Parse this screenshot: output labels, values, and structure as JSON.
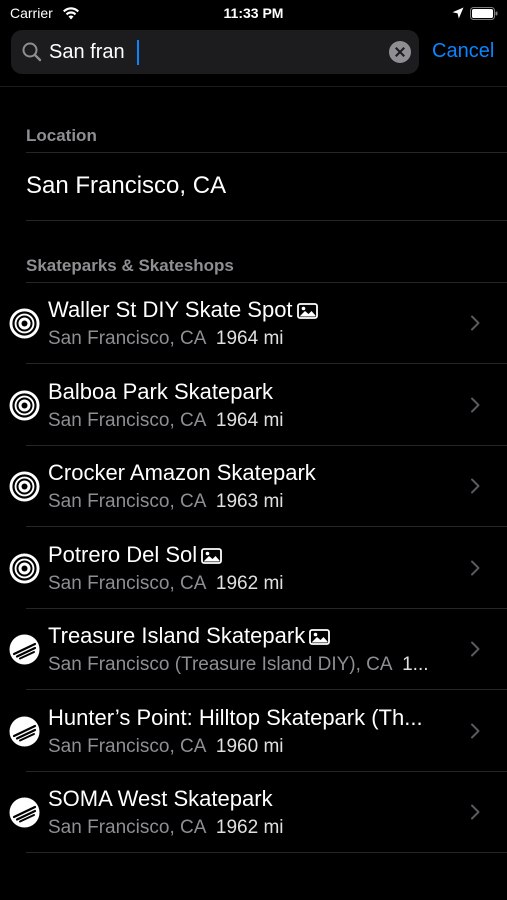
{
  "status_bar": {
    "carrier": "Carrier",
    "time": "11:33 PM"
  },
  "search": {
    "value": "San fran",
    "cancel_label": "Cancel"
  },
  "location_section": {
    "header": "Location",
    "item": "San Francisco, CA"
  },
  "parks_section": {
    "header": "Skateparks & Skateshops",
    "items": [
      {
        "title": "Waller St DIY Skate Spot",
        "subtitle": "San Francisco, CA",
        "distance": "1964 mi",
        "icon": "skatepark-bowl-icon",
        "has_photo": true
      },
      {
        "title": "Balboa Park Skatepark",
        "subtitle": "San Francisco, CA",
        "distance": "1964 mi",
        "icon": "skatepark-bowl-icon",
        "has_photo": false
      },
      {
        "title": "Crocker Amazon Skatepark",
        "subtitle": "San Francisco, CA",
        "distance": "1963 mi",
        "icon": "skatepark-bowl-icon",
        "has_photo": false
      },
      {
        "title": "Potrero Del Sol",
        "subtitle": "San Francisco, CA",
        "distance": "1962 mi",
        "icon": "skatepark-bowl-icon",
        "has_photo": true
      },
      {
        "title": "Treasure Island Skatepark",
        "subtitle": "San Francisco (Treasure Island DIY), CA",
        "distance": "1...",
        "icon": "skatepark-ramp-icon",
        "has_photo": true
      },
      {
        "title": "Hunter’s Point: Hilltop Skatepark (Th...",
        "subtitle": "San Francisco, CA",
        "distance": "1960 mi",
        "icon": "skatepark-ramp-icon",
        "has_photo": false
      },
      {
        "title": "SOMA West Skatepark",
        "subtitle": "San Francisco, CA",
        "distance": "1962 mi",
        "icon": "skatepark-ramp-icon",
        "has_photo": false
      }
    ]
  },
  "colors": {
    "accent": "#0a84ff",
    "background": "#000000",
    "secondary_text": "#8e8e93",
    "search_field": "#1c1c1e"
  }
}
